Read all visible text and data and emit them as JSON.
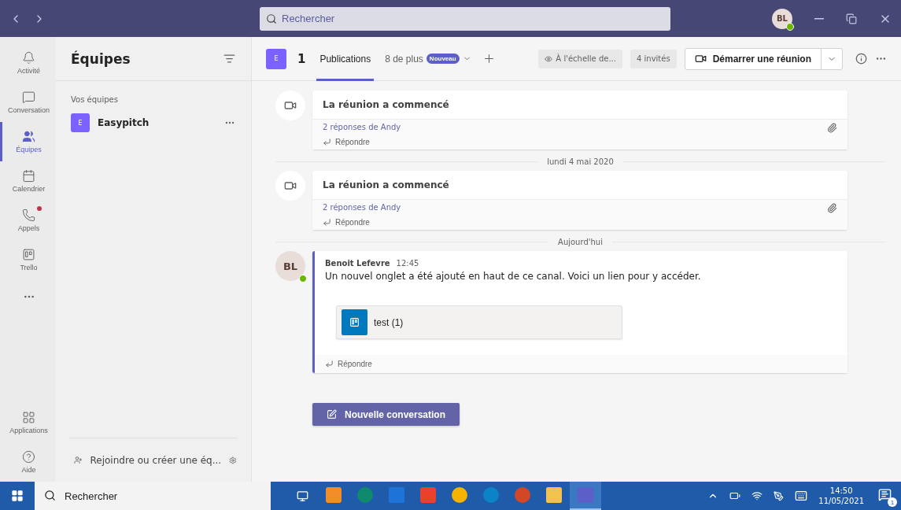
{
  "title_bar": {
    "search": {
      "placeholder": "Rechercher"
    },
    "avatar": {
      "initials": "BL",
      "online": true
    }
  },
  "rail": {
    "items": [
      {
        "label": "Activité",
        "selected": false,
        "notification": false
      },
      {
        "label": "Conversation",
        "selected": false,
        "notification": false
      },
      {
        "label": "Équipes",
        "selected": true,
        "notification": false
      },
      {
        "label": "Calendrier",
        "selected": false,
        "notification": false
      },
      {
        "label": "Appels",
        "selected": false,
        "notification": true
      },
      {
        "label": "Trello",
        "selected": false,
        "notification": false
      }
    ],
    "bottom_items": [
      {
        "label": "Applications"
      },
      {
        "label": "Aide"
      }
    ]
  },
  "teams_panel": {
    "title": "Équipes",
    "section": "Vos équipes",
    "teams": [
      {
        "initial": "E",
        "name": "Easypitch",
        "selected": false
      }
    ],
    "footer": "Rejoindre ou créer une éq..."
  },
  "channel_header": {
    "team_initial": "E",
    "channel": "1",
    "tabs": [
      {
        "label": "Publications",
        "selected": true
      },
      {
        "label": "8 de plus",
        "selected": false,
        "badge": "Nouveau"
      }
    ],
    "visibility": "À l'échelle de...",
    "guests": "4 invités",
    "meeting_button": "Démarrer une réunion"
  },
  "feed": [
    {
      "kind": "meeting",
      "title": "La réunion a commencé",
      "replies": "2 réponses de Andy",
      "reply": "Répondre"
    },
    {
      "kind": "date",
      "label": "lundi 4 mai 2020"
    },
    {
      "kind": "meeting",
      "title": "La réunion a commencé",
      "replies": "2 réponses de Andy",
      "reply": "Répondre"
    },
    {
      "kind": "date",
      "label": "Aujourd'hui"
    },
    {
      "kind": "message",
      "initials": "BL",
      "online": true,
      "author": "Benoit Lefevre",
      "time": "12:45",
      "text": "Un nouvel onglet a été ajouté en haut de ce canal. Voici un lien pour y accéder.",
      "tab_card": "test (1)",
      "reply": "Répondre"
    }
  ],
  "compose_button": "Nouvelle conversation",
  "taskbar": {
    "search": {
      "placeholder": "Rechercher"
    },
    "apps": [
      {
        "selected": false
      },
      {
        "selected": false
      },
      {
        "selected": false
      },
      {
        "selected": false
      },
      {
        "selected": false
      },
      {
        "selected": false
      },
      {
        "selected": false
      },
      {
        "selected": false
      },
      {
        "selected": true
      }
    ],
    "time": "14:50",
    "date": "11/05/2021",
    "notifications": "1"
  }
}
